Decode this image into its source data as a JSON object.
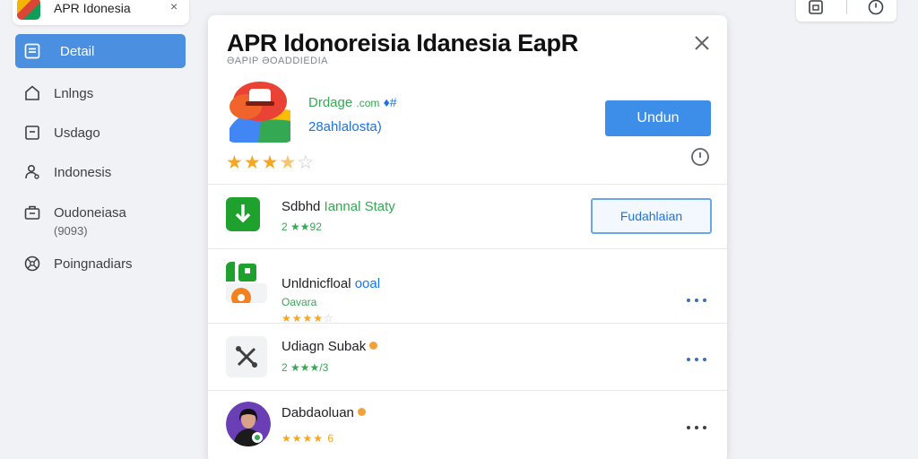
{
  "tab": {
    "title": "APR Idonesia",
    "close": "×",
    "icon": "app-logo-icon"
  },
  "window_controls": {
    "left_icon": "save-icon",
    "right_icon": "clock-icon"
  },
  "sidebar": {
    "items": [
      {
        "label": "Detail",
        "icon": "list-icon",
        "active": true
      },
      {
        "label": "Lnlngs",
        "icon": "home-icon"
      },
      {
        "label": "Usdago",
        "icon": "document-icon"
      },
      {
        "label": "Indonesis",
        "icon": "user-icon"
      },
      {
        "label": "Oudoneiasa",
        "sub": "(9093)",
        "icon": "briefcase-icon"
      },
      {
        "label": "Poingnadiars",
        "icon": "settings-icon"
      }
    ]
  },
  "dialog": {
    "title": "APR Idonoreisia Idanesia EapR",
    "subtitle": "ƏAPIP ƏOADDIEDIA",
    "app": {
      "developer": "Drdage",
      "developer_suffix": ".com",
      "developer_mark": "♦#",
      "package": "28ahlalosta)",
      "rating": 3.5,
      "install_label": "Undun"
    },
    "related": [
      {
        "title": "Sdbhd",
        "title_accent": "Iannal Staty",
        "meta": "2 ★★92",
        "action_label": "Fudahlaian",
        "icon": "download-icon"
      },
      {
        "title": "Unldnicfloal",
        "title_accent": "ooal",
        "meta": "Oavara",
        "rating": 4,
        "icon": "app-grid-icon"
      },
      {
        "title": "Udiagn Subak",
        "meta": "2 ★★★/3",
        "icon": "tools-icon"
      },
      {
        "title": "Dabdaoluan",
        "rating_text": "★★★★ 6",
        "icon": "avatar-icon"
      }
    ]
  },
  "colors": {
    "accent": "#4a8fe0",
    "install": "#3d8ee8",
    "green_text": "#34a853",
    "blue_text": "#1a73e8",
    "star": "#f6a623"
  }
}
